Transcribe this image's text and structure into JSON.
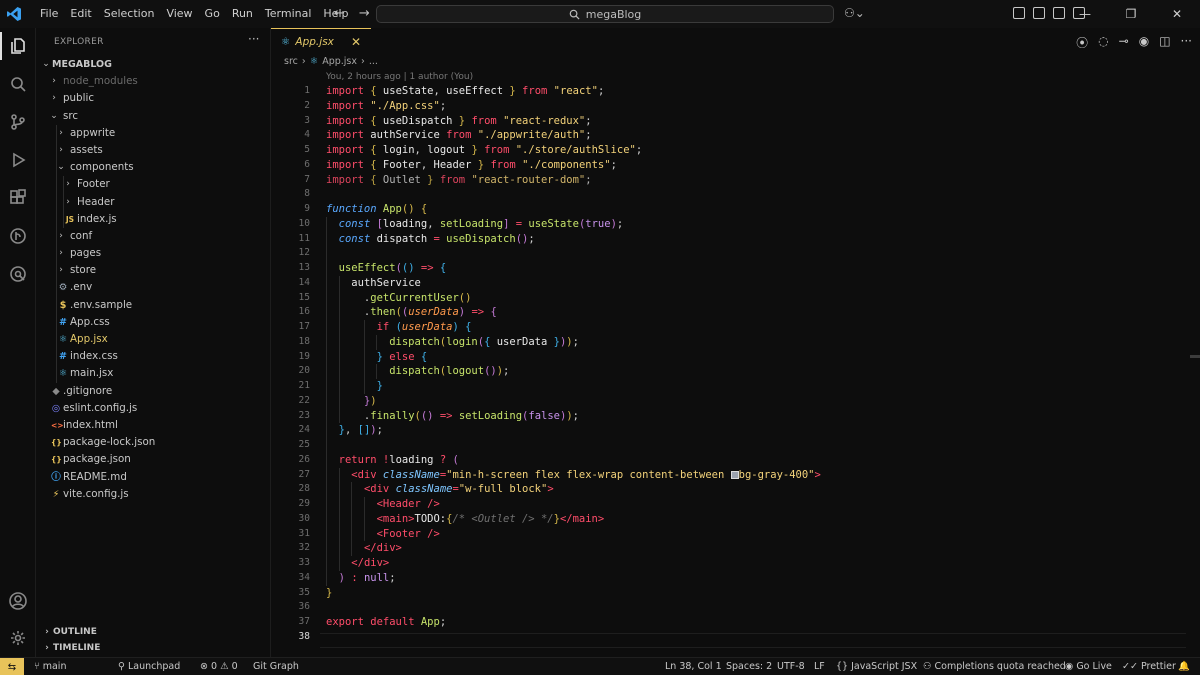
{
  "menu": [
    "File",
    "Edit",
    "Selection",
    "View",
    "Go",
    "Run",
    "Terminal",
    "Help"
  ],
  "search_text": "megaBlog",
  "explorer": {
    "title": "EXPLORER",
    "root": "MEGABLOG",
    "items": [
      {
        "label": "node_modules",
        "kind": "folder",
        "depth": 1,
        "open": false,
        "dim": true
      },
      {
        "label": "public",
        "kind": "folder",
        "depth": 1,
        "open": false
      },
      {
        "label": "src",
        "kind": "folder",
        "depth": 1,
        "open": true
      },
      {
        "label": "appwrite",
        "kind": "folder",
        "depth": 2,
        "open": false
      },
      {
        "label": "assets",
        "kind": "folder",
        "depth": 2,
        "open": false
      },
      {
        "label": "components",
        "kind": "folder",
        "depth": 2,
        "open": true
      },
      {
        "label": "Footer",
        "kind": "folder",
        "depth": 3,
        "open": false
      },
      {
        "label": "Header",
        "kind": "folder",
        "depth": 3,
        "open": false
      },
      {
        "label": "index.js",
        "kind": "js",
        "depth": 3
      },
      {
        "label": "conf",
        "kind": "folder",
        "depth": 2,
        "open": false
      },
      {
        "label": "pages",
        "kind": "folder",
        "depth": 2,
        "open": false
      },
      {
        "label": "store",
        "kind": "folder",
        "depth": 2,
        "open": false
      },
      {
        "label": ".env",
        "kind": "gear",
        "depth": 2
      },
      {
        "label": ".env.sample",
        "kind": "dollar",
        "depth": 2
      },
      {
        "label": "App.css",
        "kind": "hash",
        "depth": 2
      },
      {
        "label": "App.jsx",
        "kind": "react",
        "depth": 2,
        "active": true
      },
      {
        "label": "index.css",
        "kind": "hash",
        "depth": 2
      },
      {
        "label": "main.jsx",
        "kind": "react",
        "depth": 2
      },
      {
        "label": ".gitignore",
        "kind": "git",
        "depth": 1
      },
      {
        "label": "eslint.config.js",
        "kind": "eslint",
        "depth": 1
      },
      {
        "label": "index.html",
        "kind": "html",
        "depth": 1
      },
      {
        "label": "package-lock.json",
        "kind": "json",
        "depth": 1
      },
      {
        "label": "package.json",
        "kind": "json",
        "depth": 1
      },
      {
        "label": "README.md",
        "kind": "info",
        "depth": 1
      },
      {
        "label": "vite.config.js",
        "kind": "vite",
        "depth": 1
      }
    ],
    "panels": [
      "OUTLINE",
      "TIMELINE"
    ]
  },
  "tab": {
    "label": "App.jsx"
  },
  "breadcrumb": [
    "src",
    "App.jsx",
    "..."
  ],
  "blame": "You, 2 hours ago | 1 author (You)",
  "current_line": 38,
  "status": {
    "branch": "main",
    "launchpad": "Launchpad",
    "errors": "0",
    "warnings": "0",
    "git_graph": "Git Graph",
    "position": "Ln 38, Col 1",
    "spaces": "Spaces: 2",
    "encoding": "UTF-8",
    "eol": "LF",
    "language": "JavaScript JSX",
    "completions": "Completions quota reached",
    "go_live": "Go Live",
    "prettier": "Prettier"
  },
  "colors": {
    "accent": "#e8c35a",
    "keyword": "#ff4d6a",
    "string": "#f3d27a",
    "function": "#c6e36a"
  }
}
